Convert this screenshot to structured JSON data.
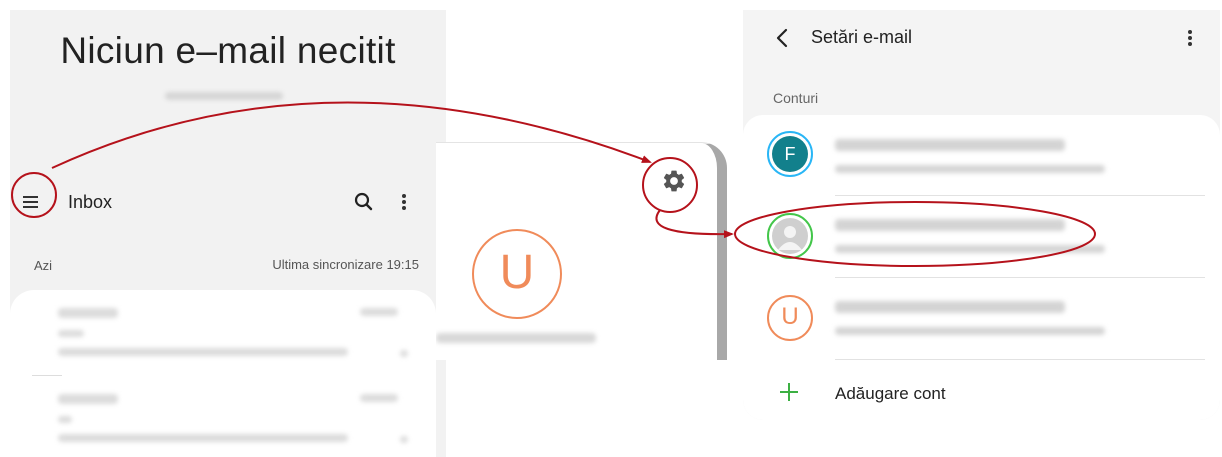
{
  "inbox_screen": {
    "empty_title": "Niciun e–mail necitit",
    "toolbar": {
      "title": "Inbox"
    },
    "section_today": "Azi",
    "last_sync": "Ultima sincronizare 19:15"
  },
  "drawer_screen": {
    "avatar_letter": "U"
  },
  "settings_screen": {
    "title": "Setări e-mail",
    "accounts_section": "Conturi",
    "accounts": [
      {
        "avatar": "F"
      },
      {
        "avatar": ""
      },
      {
        "avatar": "U"
      }
    ],
    "add_account": "Adăugare cont"
  },
  "colors": {
    "annotation": "#b5121b",
    "accent_orange": "#f08b5a",
    "accent_teal": "#12808c",
    "accent_green": "#3cb043",
    "panel_bg": "#f2f2f2"
  },
  "icons": [
    "menu-icon",
    "search-icon",
    "more-vert-icon",
    "gear-icon",
    "back-arrow-icon",
    "plus-icon",
    "person-icon"
  ]
}
